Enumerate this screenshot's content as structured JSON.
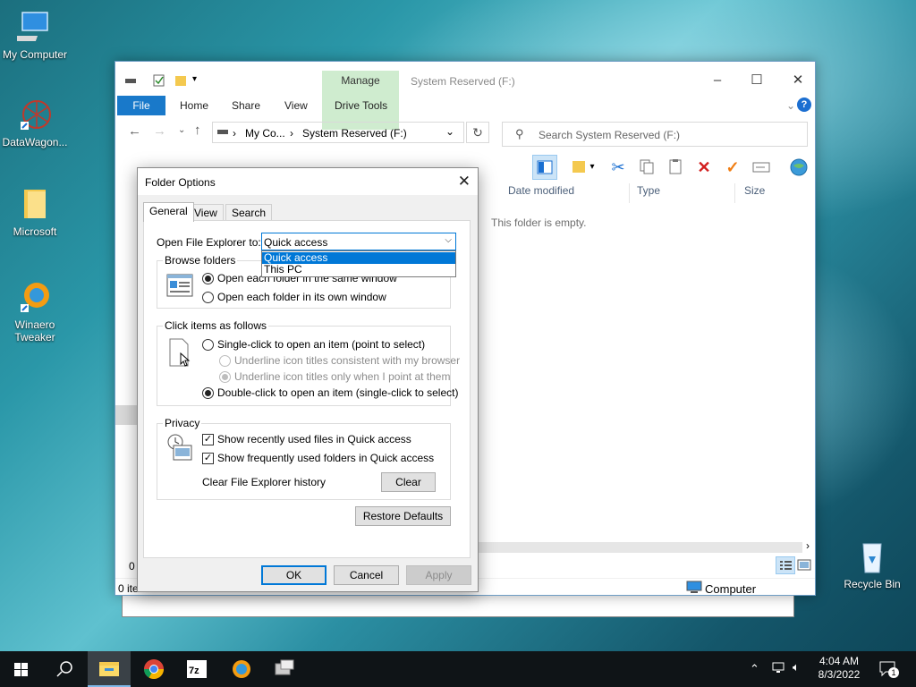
{
  "desktop": {
    "icons": [
      {
        "label": "My Computer"
      },
      {
        "label": "DataWagon..."
      },
      {
        "label": "Microsoft"
      },
      {
        "label": "Winaero\nTweaker"
      },
      {
        "label": "Recycle Bin"
      }
    ]
  },
  "explorer": {
    "title": "System Reserved (F:)",
    "manage_tab": "Manage",
    "tabs": {
      "file": "File",
      "home": "Home",
      "share": "Share",
      "view": "View",
      "drive_tools": "Drive Tools"
    },
    "breadcrumb": {
      "part1": "My Co...",
      "part2": "System Reserved (F:)"
    },
    "search_placeholder": "Search System Reserved (F:)",
    "columns": {
      "date_modified": "Date modified",
      "type": "Type",
      "size": "Size"
    },
    "empty_message": "This folder is empty.",
    "status_items": "0 ite",
    "status_left_count": "0",
    "status_location": "Computer"
  },
  "dialog": {
    "title": "Folder Options",
    "tabs": {
      "general": "General",
      "view": "View",
      "search": "Search"
    },
    "open_explorer_label": "Open File Explorer to:",
    "open_explorer_value": "Quick access",
    "dropdown_options": [
      "Quick access",
      "This PC"
    ],
    "browse_group": "Browse folders",
    "browse_same": "Open each folder in the same window",
    "browse_own": "Open each folder in its own window",
    "click_group": "Click items as follows",
    "single_click": "Single-click to open an item (point to select)",
    "underline_consistent": "Underline icon titles consistent with my browser",
    "underline_point": "Underline icon titles only when I point at them",
    "double_click": "Double-click to open an item (single-click to select)",
    "privacy_group": "Privacy",
    "show_recent": "Show recently used files in Quick access",
    "show_frequent": "Show frequently used folders in Quick access",
    "clear_history_label": "Clear File Explorer history",
    "clear_button": "Clear",
    "restore_button": "Restore Defaults",
    "ok_button": "OK",
    "cancel_button": "Cancel",
    "apply_button": "Apply"
  },
  "taskbar": {
    "time": "4:04 AM",
    "date": "8/3/2022",
    "notification_count": "1"
  },
  "colors": {
    "accent": "#0078d7",
    "file_tab": "#1979ca",
    "manage_tab": "#cfeccf"
  }
}
